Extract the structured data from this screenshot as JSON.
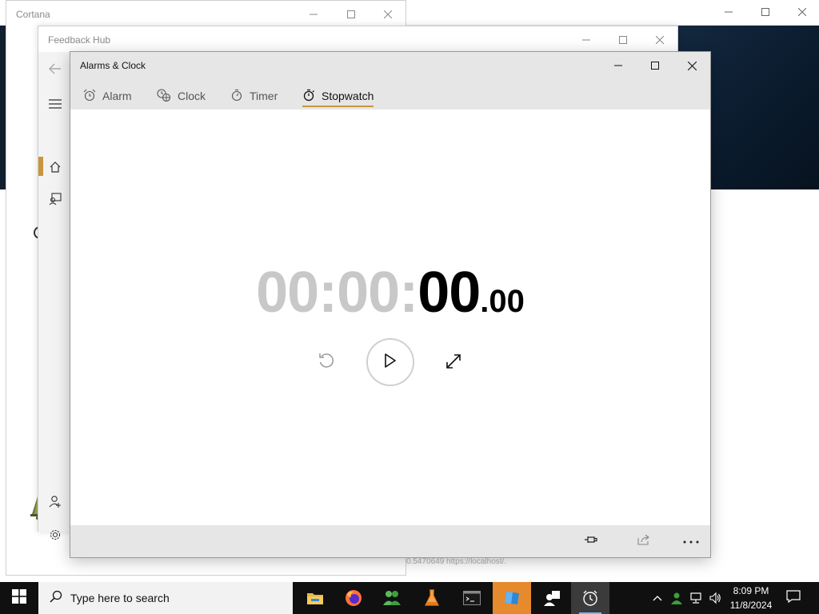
{
  "windows": {
    "cortana": {
      "title": "Cortana"
    },
    "feedback_hub": {
      "title": "Feedback Hub"
    },
    "alarms": {
      "title": "Alarms & Clock"
    }
  },
  "alarms": {
    "tabs": [
      {
        "label": "Alarm",
        "icon": "alarm-icon",
        "active": false
      },
      {
        "label": "Clock",
        "icon": "world-clock-icon",
        "active": false
      },
      {
        "label": "Timer",
        "icon": "timer-icon",
        "active": false
      },
      {
        "label": "Stopwatch",
        "icon": "stopwatch-icon",
        "active": true
      }
    ],
    "stopwatch": {
      "hours_minutes": "00:00:",
      "seconds": "00",
      "hundredths": ".00"
    },
    "accent_color": "#c8963e"
  },
  "background_text": {
    "url_fragment": "0.5470649 https://localhost/."
  },
  "taskbar": {
    "search_placeholder": "Type here to search",
    "time": "8:09 PM",
    "date": "11/8/2024",
    "apps": [
      "file-explorer-icon",
      "firefox-icon",
      "people-icon",
      "lab-flask-icon",
      "terminal-icon",
      "app-blue-icon",
      "user-switch-icon",
      "alarms-clock-icon"
    ]
  }
}
